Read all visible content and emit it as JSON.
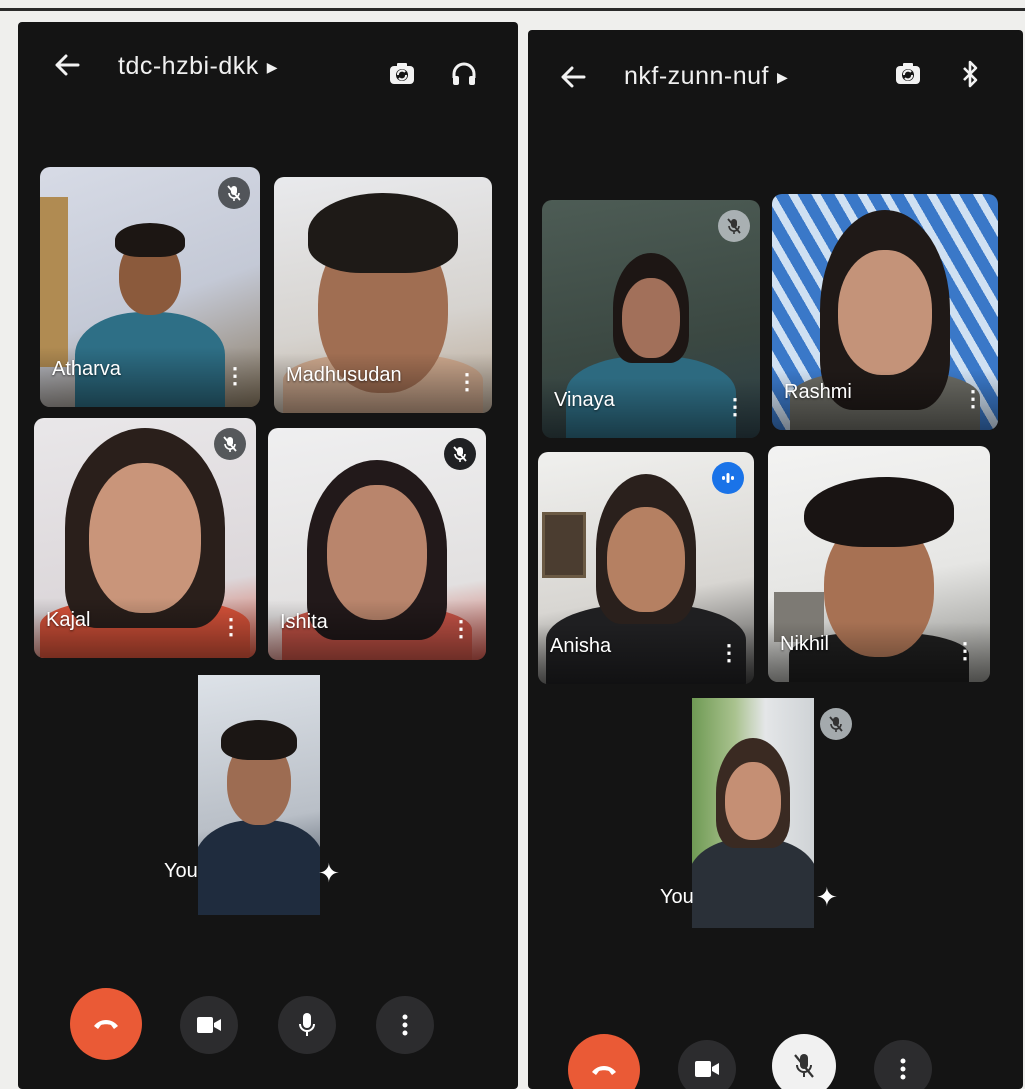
{
  "left": {
    "meeting_code": "tdc-hzbi-dkk",
    "participants": [
      {
        "name": "Atharva",
        "muted": true
      },
      {
        "name": "Madhusudan",
        "muted": false
      },
      {
        "name": "Kajal",
        "muted": true
      },
      {
        "name": "Ishita",
        "muted": true
      }
    ],
    "self_label": "You",
    "header_icons": [
      "back-arrow-icon",
      "switch-camera-icon",
      "headphones-icon"
    ],
    "controls": [
      "end-call-icon",
      "camera-icon",
      "microphone-icon",
      "more-options-icon"
    ]
  },
  "right": {
    "meeting_code": "nkf-zunn-nuf",
    "participants": [
      {
        "name": "Vinaya",
        "muted": true
      },
      {
        "name": "Rashmi",
        "muted": false
      },
      {
        "name": "Anisha",
        "speaking": true
      },
      {
        "name": "Nikhil",
        "muted": false
      }
    ],
    "self_label": "You",
    "header_icons": [
      "back-arrow-icon",
      "switch-camera-icon",
      "bluetooth-icon"
    ],
    "controls": [
      "end-call-icon",
      "camera-icon",
      "microphone-off-icon",
      "more-options-icon"
    ]
  },
  "colors": {
    "end_call": "#ea5a36",
    "speaking_indicator": "#1a73e8",
    "background": "#141414"
  }
}
